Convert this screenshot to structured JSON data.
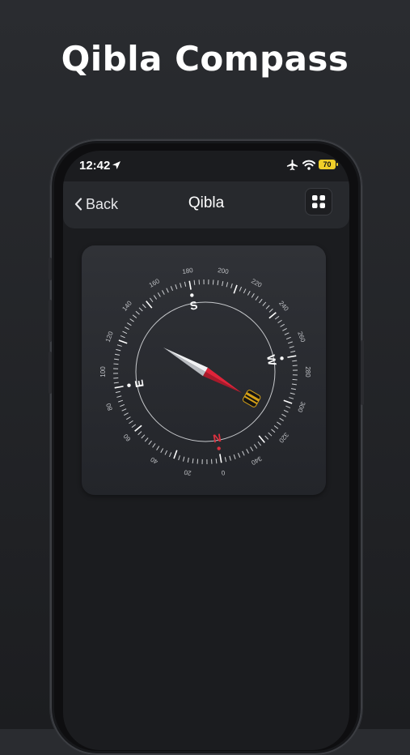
{
  "headline": "Qibla Compass",
  "status_bar": {
    "time": "12:42",
    "battery": "70"
  },
  "nav": {
    "back_label": "Back",
    "title": "Qibla"
  },
  "compass": {
    "tick_labels": [
      "0",
      "20",
      "40",
      "60",
      "80",
      "100",
      "120",
      "140",
      "160",
      "180",
      "200",
      "220",
      "240",
      "260",
      "280",
      "300",
      "320",
      "340"
    ],
    "cardinals": {
      "north": "N",
      "east": "E",
      "south": "S",
      "west": "W"
    },
    "needle_bearing_deg": 300,
    "colors": {
      "north_red": "#d9313f",
      "needle_red": "#e0243a",
      "kaaba_gold": "#d4a017"
    }
  }
}
